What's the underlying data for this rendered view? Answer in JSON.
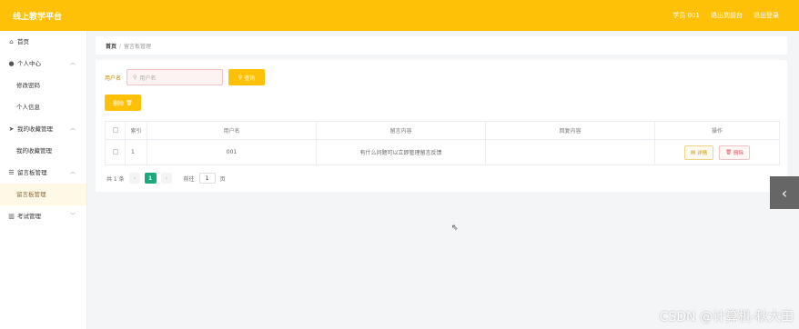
{
  "header": {
    "title": "线上教学平台",
    "user": "学员 001",
    "exit_frontend": "退出到前台",
    "logout": "退出登录"
  },
  "sidebar": {
    "home": "首页",
    "personal_center": "个人中心",
    "change_password": "修改密码",
    "personal_info": "个人信息",
    "favorites": "我的收藏管理",
    "favorites_sub": "我的收藏管理",
    "messages": "留言板管理",
    "messages_sub": "留言板管理",
    "exams": "考试管理"
  },
  "breadcrumb": {
    "home": "首页",
    "separator": "/",
    "current": "留言板管理"
  },
  "search": {
    "label": "用户名",
    "placeholder": "用户名",
    "button": "查询"
  },
  "toolbar": {
    "delete_label": "删除"
  },
  "table": {
    "headers": [
      "索引",
      "用户名",
      "留言内容",
      "回复内容",
      "操作"
    ],
    "rows": [
      {
        "index": "1",
        "username": "001",
        "message": "有什么问题可以立即管理留言反馈",
        "reply": ""
      }
    ],
    "detail_label": "详情",
    "delete_label": "删除"
  },
  "pagination": {
    "total": "共 1 条",
    "prev": "‹",
    "current_page": "1",
    "next": "›",
    "goto_label": "前往",
    "goto_value": "1",
    "page_unit": "页"
  },
  "side_tab_icon": "‹",
  "watermark": "CSDN @计算机-秋大田",
  "colors": {
    "accent": "#ffc107",
    "active_page": "#1aa97b"
  }
}
